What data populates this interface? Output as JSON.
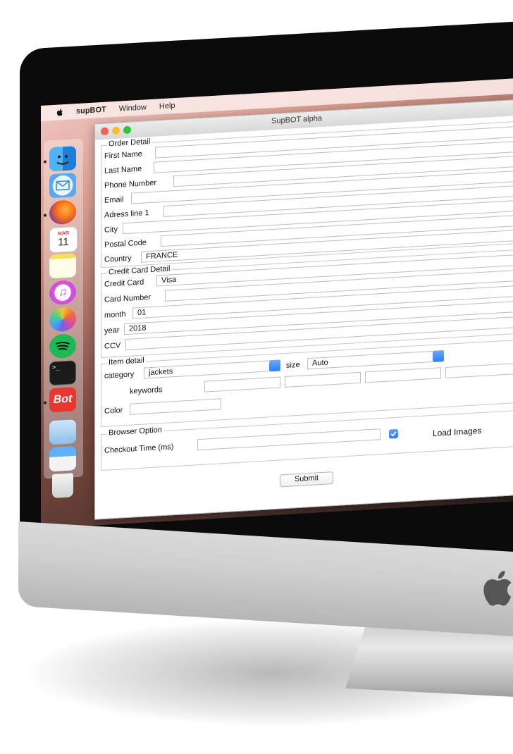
{
  "menubar": {
    "app_name": "supBOT",
    "items": [
      "Window",
      "Help"
    ]
  },
  "window": {
    "title": "SupBOT alpha"
  },
  "dock": {
    "icons": [
      "finder-icon",
      "mail-icon",
      "firefox-icon",
      "calendar-icon",
      "notes-icon",
      "itunes-icon",
      "photos-icon",
      "spotify-icon",
      "terminal-icon",
      "bot-icon",
      "preview-icon",
      "keynote-icon",
      "trash-icon"
    ],
    "calendar": {
      "month": "MAR",
      "day": "11"
    },
    "bot_label": "Bot",
    "terminal_label": ">_"
  },
  "order_detail": {
    "title": "Order Detail",
    "first_name_label": "First Name",
    "last_name_label": "Last Name",
    "phone_label": "Phone Number",
    "email_label": "Email",
    "address_label": "Adress line 1",
    "city_label": "City",
    "postal_label": "Postal Code",
    "country_label": "Country",
    "country_value": "FRANCE"
  },
  "credit_card": {
    "title": "Credit Card Detail",
    "card_label": "Credit Card",
    "card_value": "Visa",
    "number_label": "Card Number",
    "month_label": "month",
    "month_value": "01",
    "year_label": "year",
    "year_value": "2018",
    "ccv_label": "CCV"
  },
  "item_detail": {
    "title": "Item detail",
    "category_label": "category",
    "category_value": "jackets",
    "size_label": "size",
    "size_value": "Auto",
    "keywords_label": "keywords",
    "color_label": "Color"
  },
  "browser_option": {
    "title": "Browser Option",
    "checkout_label": "Checkout Time (ms)",
    "load_images_label": "Load Images",
    "load_images_checked": true
  },
  "submit_label": "Submit",
  "colors": {
    "accent": "#2d7ef7",
    "bot_red": "#e8372f"
  }
}
